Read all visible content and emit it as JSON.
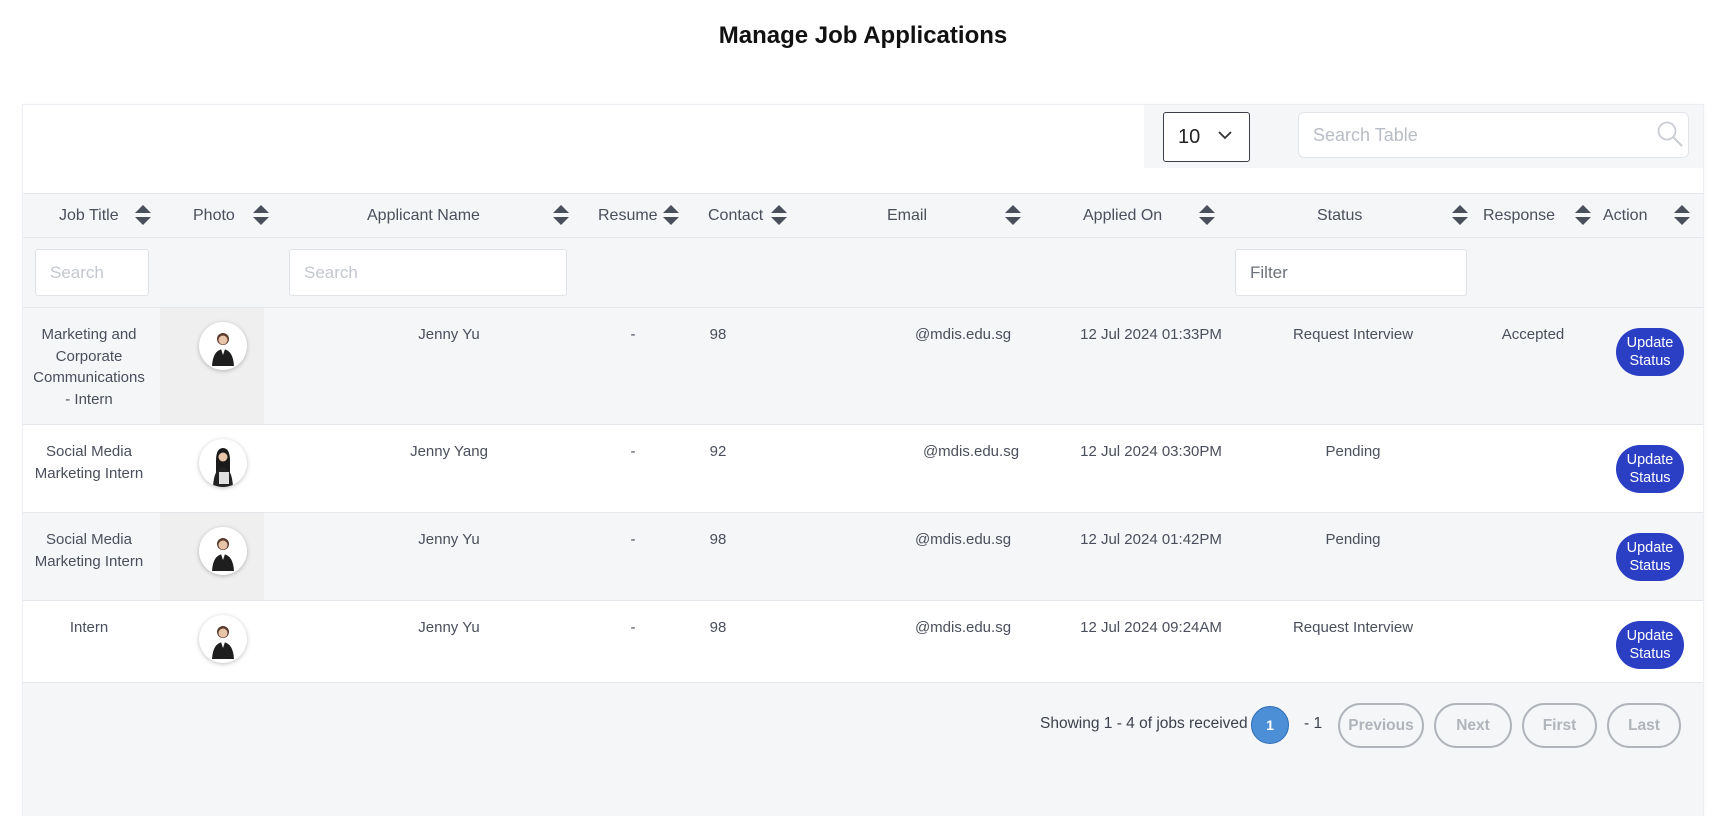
{
  "page": {
    "title": "Manage Job Applications"
  },
  "toolbar": {
    "page_size": "10",
    "search_placeholder": "Search Table"
  },
  "table": {
    "headers": {
      "job_title": "Job Title",
      "photo": "Photo",
      "applicant_name": "Applicant Name",
      "resume": "Resume",
      "contact": "Contact",
      "email": "Email",
      "applied_on": "Applied On",
      "status": "Status",
      "response": "Response",
      "action": "Action"
    },
    "filters": {
      "job_title_placeholder": "Search",
      "applicant_name_placeholder": "Search",
      "status_placeholder": "Filter"
    },
    "rows": [
      {
        "job_title": "Marketing and Corporate Communications - Intern",
        "applicant_name": "Jenny Yu",
        "resume": "-",
        "contact": "98",
        "email": "@mdis.edu.sg",
        "applied_on": "12 Jul 2024 01:33PM",
        "status": "Request Interview",
        "response": "Accepted",
        "action": "Update Status"
      },
      {
        "job_title": "Social Media Marketing Intern",
        "applicant_name": "Jenny Yang",
        "resume": "-",
        "contact": "92",
        "email": "@mdis.edu.sg",
        "applied_on": "12 Jul 2024 03:30PM",
        "status": "Pending",
        "response": "",
        "action": "Update Status"
      },
      {
        "job_title": "Social Media Marketing Intern",
        "applicant_name": "Jenny Yu",
        "resume": "-",
        "contact": "98",
        "email": "@mdis.edu.sg",
        "applied_on": "12 Jul 2024 01:42PM",
        "status": "Pending",
        "response": "",
        "action": "Update Status"
      },
      {
        "job_title": "Intern",
        "applicant_name": "Jenny Yu",
        "resume": "-",
        "contact": "98",
        "email": "@mdis.edu.sg",
        "applied_on": "12 Jul 2024 09:24AM",
        "status": "Request Interview",
        "response": "",
        "action": "Update Status"
      }
    ]
  },
  "pagination": {
    "showing": "Showing 1 - 4 of jobs received",
    "current_page": "1",
    "total_pages": "- 1",
    "previous": "Previous",
    "next": "Next",
    "first": "First",
    "last": "Last"
  },
  "colors": {
    "accent": "#2b3fc4",
    "page_current": "#4d8fd6",
    "header_bg": "#f5f6f8"
  }
}
